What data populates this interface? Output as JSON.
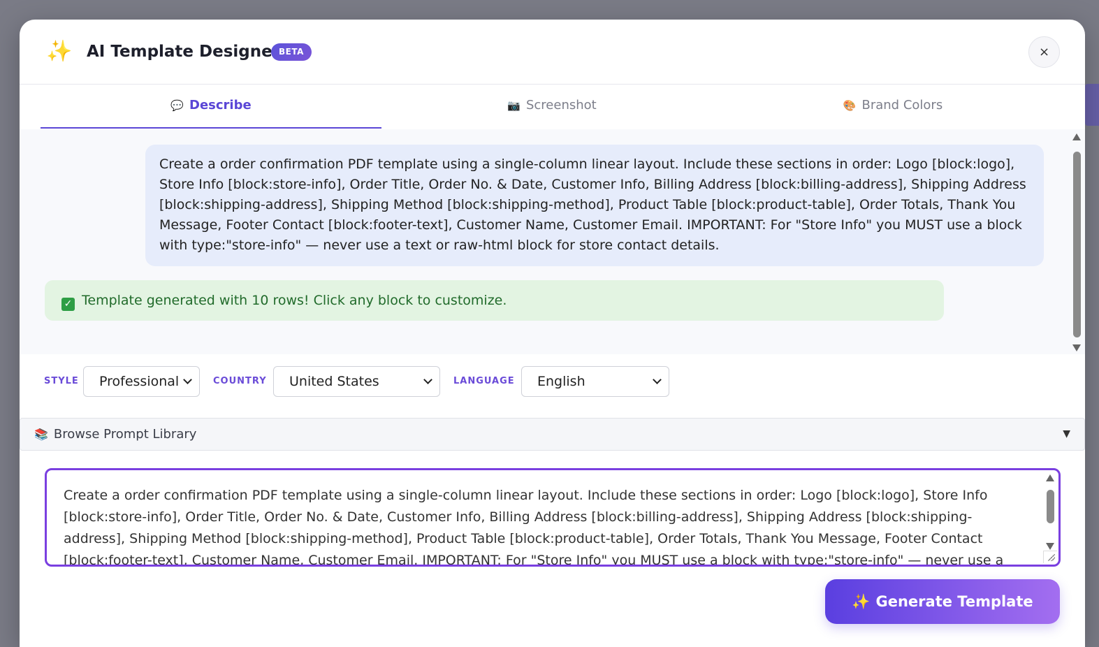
{
  "header": {
    "title": "AI Template Designer",
    "badge": "BETA",
    "close": "×"
  },
  "tabs": [
    {
      "icon": "💬",
      "label": "Describe",
      "active": true
    },
    {
      "icon": "📷",
      "label": "Screenshot",
      "active": false
    },
    {
      "icon": "🎨",
      "label": "Brand Colors",
      "active": false
    }
  ],
  "chat": {
    "user_message": "Create a order confirmation PDF template using a single-column linear layout. Include these sections in order: Logo [block:logo], Store Info [block:store-info], Order Title, Order No. & Date, Customer Info, Billing Address [block:billing-address], Shipping Address [block:shipping-address], Shipping Method [block:shipping-method], Product Table [block:product-table], Order Totals, Thank You Message, Footer Contact [block:footer-text], Customer Name, Customer Email. IMPORTANT: For \"Store Info\" you MUST use a block with type:\"store-info\" — never use a text or raw-html block for store contact details.",
    "success_message": "Template generated with 10 rows! Click any block to customize."
  },
  "controls": {
    "style_label": "STYLE",
    "style_value": "Professional",
    "country_label": "COUNTRY",
    "country_value": "United States",
    "language_label": "LANGUAGE",
    "language_value": "English"
  },
  "library": {
    "icon": "📚",
    "label": "Browse Prompt Library",
    "toggle": "▼"
  },
  "prompt": {
    "value": "Create a order confirmation PDF template using a single-column linear layout. Include these sections in order: Logo [block:logo], Store Info [block:store-info], Order Title, Order No. & Date, Customer Info, Billing Address [block:billing-address], Shipping Address [block:shipping-address], Shipping Method [block:shipping-method], Product Table [block:product-table], Order Totals, Thank You Message, Footer Contact [block:footer-text], Customer Name, Customer Email. IMPORTANT: For \"Store Info\" you MUST use a block with type:\"store-info\" — never use a text or raw-html block for store contact details."
  },
  "generate_button": {
    "icon": "✨",
    "label": "Generate Template"
  },
  "colors": {
    "accent": "#5a46d6",
    "success_bg": "#e3f4e2",
    "success_text": "#216b2b",
    "user_bubble": "#e6ecfb",
    "focus_border": "#7a3fe0"
  }
}
